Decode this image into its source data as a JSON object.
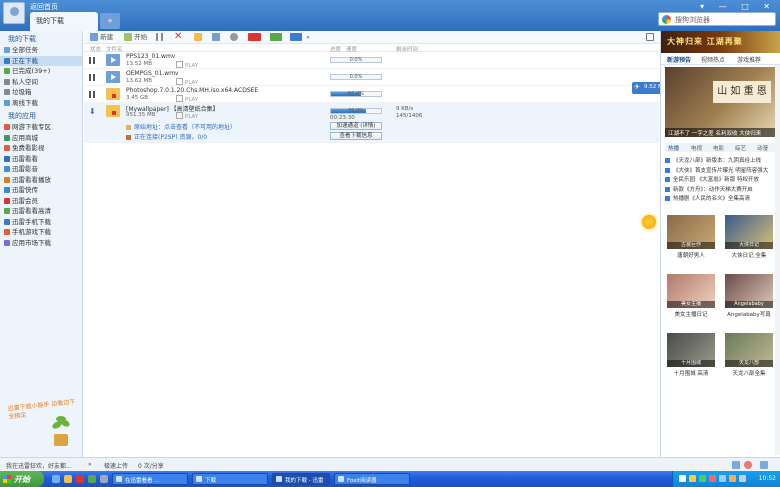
{
  "window": {
    "back_label": "返回首页",
    "tab_label": "我的下载",
    "tab_add": "+",
    "controls": "▾ — □ ✕",
    "search_placeholder": "搜狗浏览器"
  },
  "sidebar": {
    "section1": "我的下载",
    "items1": [
      {
        "label": "全部任务",
        "color": "#6f9fd8"
      },
      {
        "label": "正在下载",
        "color": "#3a7cd0"
      },
      {
        "label": "已完成(39+)",
        "color": "#5aa84a"
      },
      {
        "label": "私人空间",
        "color": "#888"
      },
      {
        "label": "垃圾箱",
        "color": "#888"
      },
      {
        "label": "离线下载",
        "color": "#5b9be0"
      }
    ],
    "section2": "我的应用",
    "items2": [
      {
        "label": "网游下载专区",
        "color": "#e45a3a"
      },
      {
        "label": "应用商城",
        "color": "#3a9a5a"
      },
      {
        "label": "免费看影视",
        "color": "#e45a3a"
      },
      {
        "label": "迅雷看看",
        "color": "#2f6fbd"
      },
      {
        "label": "迅雷影音",
        "color": "#4a8ad8"
      },
      {
        "label": "迅雷看看播放",
        "color": "#e07b20"
      },
      {
        "label": "迅雷快传",
        "color": "#3a8ad0"
      },
      {
        "label": "迅雷会员",
        "color": "#d33"
      },
      {
        "label": "迅雷看看高清",
        "color": "#5aa84a"
      },
      {
        "label": "迅雷手机下载",
        "color": "#3a7cd0"
      },
      {
        "label": "手机游戏下载",
        "color": "#e45a3a"
      },
      {
        "label": "应用市场下载",
        "color": "#6f6fd8"
      }
    ],
    "promo": "迅雷下载小能手 边看边下全搞定"
  },
  "toolbar": {
    "new_label": "新建",
    "start_label": "开始",
    "more": "»"
  },
  "columns": {
    "status": "状态",
    "name": "文件名",
    "progress": "进度",
    "speed": "速度",
    "remaining": "剩余时间"
  },
  "tasks": [
    {
      "name": "PPS123_01.wmv",
      "size": "13.52 MB",
      "play": "PLAY",
      "progress": 0.0,
      "percent": "0.0%"
    },
    {
      "name": "OEMPGS_01.wmv",
      "size": "13.62 MB",
      "play": "PLAY",
      "progress": 0.0,
      "percent": "0.0%"
    },
    {
      "name": "Photoshop.7.0.1.20.Chs.MH.iso.x64.ACDSEE",
      "size": "3.45 GB",
      "play": "PLAY",
      "progress": 0.6,
      "percent": "60.0%"
    },
    {
      "name": "[Mywallpaper] 【高清壁纸合集】",
      "size": "951.35 MB",
      "play": "PLAY",
      "progress": 0.7,
      "percent": "70.0%",
      "elapsed": "00:23:30",
      "speed": "9 KB/s",
      "speed2": "145/1406",
      "sub1": "原始地址：点击查看（不可用的地址）",
      "sub2": "正在连接(P2SP) 资源，0/0",
      "btn1": "加速通道 (详情)",
      "btn2": "查看下载信息"
    }
  ],
  "float_tip": "9.52 MB/s",
  "right_panel": {
    "banner": "大神归来 江湖再聚",
    "tabs": [
      "新游预告",
      "视频热点",
      "游戏推荐"
    ],
    "feature_scroll": "山 如 重 恩",
    "feature_caption": "江湖不了 一字之差 名利双收 大侠归来",
    "categories": [
      "热播",
      "电视",
      "电影",
      "综艺",
      "动漫"
    ],
    "news": [
      "《天龙八部》新版本：九阴真经上线",
      "《大侠》首支宣传片曝光 明星阵容强大",
      "全民乐园 《大富翁》新版 特权开放",
      "新款《方舟》：动作天梯大赛开启",
      "热播剧《人民的名义》全集高清"
    ],
    "thumbs": [
      {
        "overlay": "古装巨作",
        "title": "唐朝好男人",
        "color1": "#8a6a4a",
        "color2": "#c9a874"
      },
      {
        "overlay": "大侠日记",
        "title": "大侠日记 全集",
        "color1": "#3a5a8a",
        "color2": "#d9c07a"
      },
      {
        "overlay": "美女主播",
        "title": "美女主播日记",
        "color1": "#b07a6a",
        "color2": "#f0d0c0"
      },
      {
        "overlay": "Angelababy",
        "title": "Angelababy写真",
        "color1": "#6a4a4a",
        "color2": "#e0c8b8"
      },
      {
        "overlay": "十月围城",
        "title": "十月围城 高清",
        "color1": "#4a4a4a",
        "color2": "#9a9a8a"
      },
      {
        "overlay": "天龙八部",
        "title": "天龙八部全集",
        "color1": "#6a7a5a",
        "color2": "#c0b890"
      }
    ]
  },
  "statusbar": {
    "left": "我在迅雷狂欢，好友都...",
    "more": "»",
    "mid": "极速上传",
    "right": "0 次/分享"
  },
  "taskbar": {
    "start": "开始",
    "tasks": [
      "在迅雷看看 ...",
      "下载",
      "我的下载 - 迅雷",
      "Foxit阅读器"
    ],
    "clock": "10:52"
  }
}
